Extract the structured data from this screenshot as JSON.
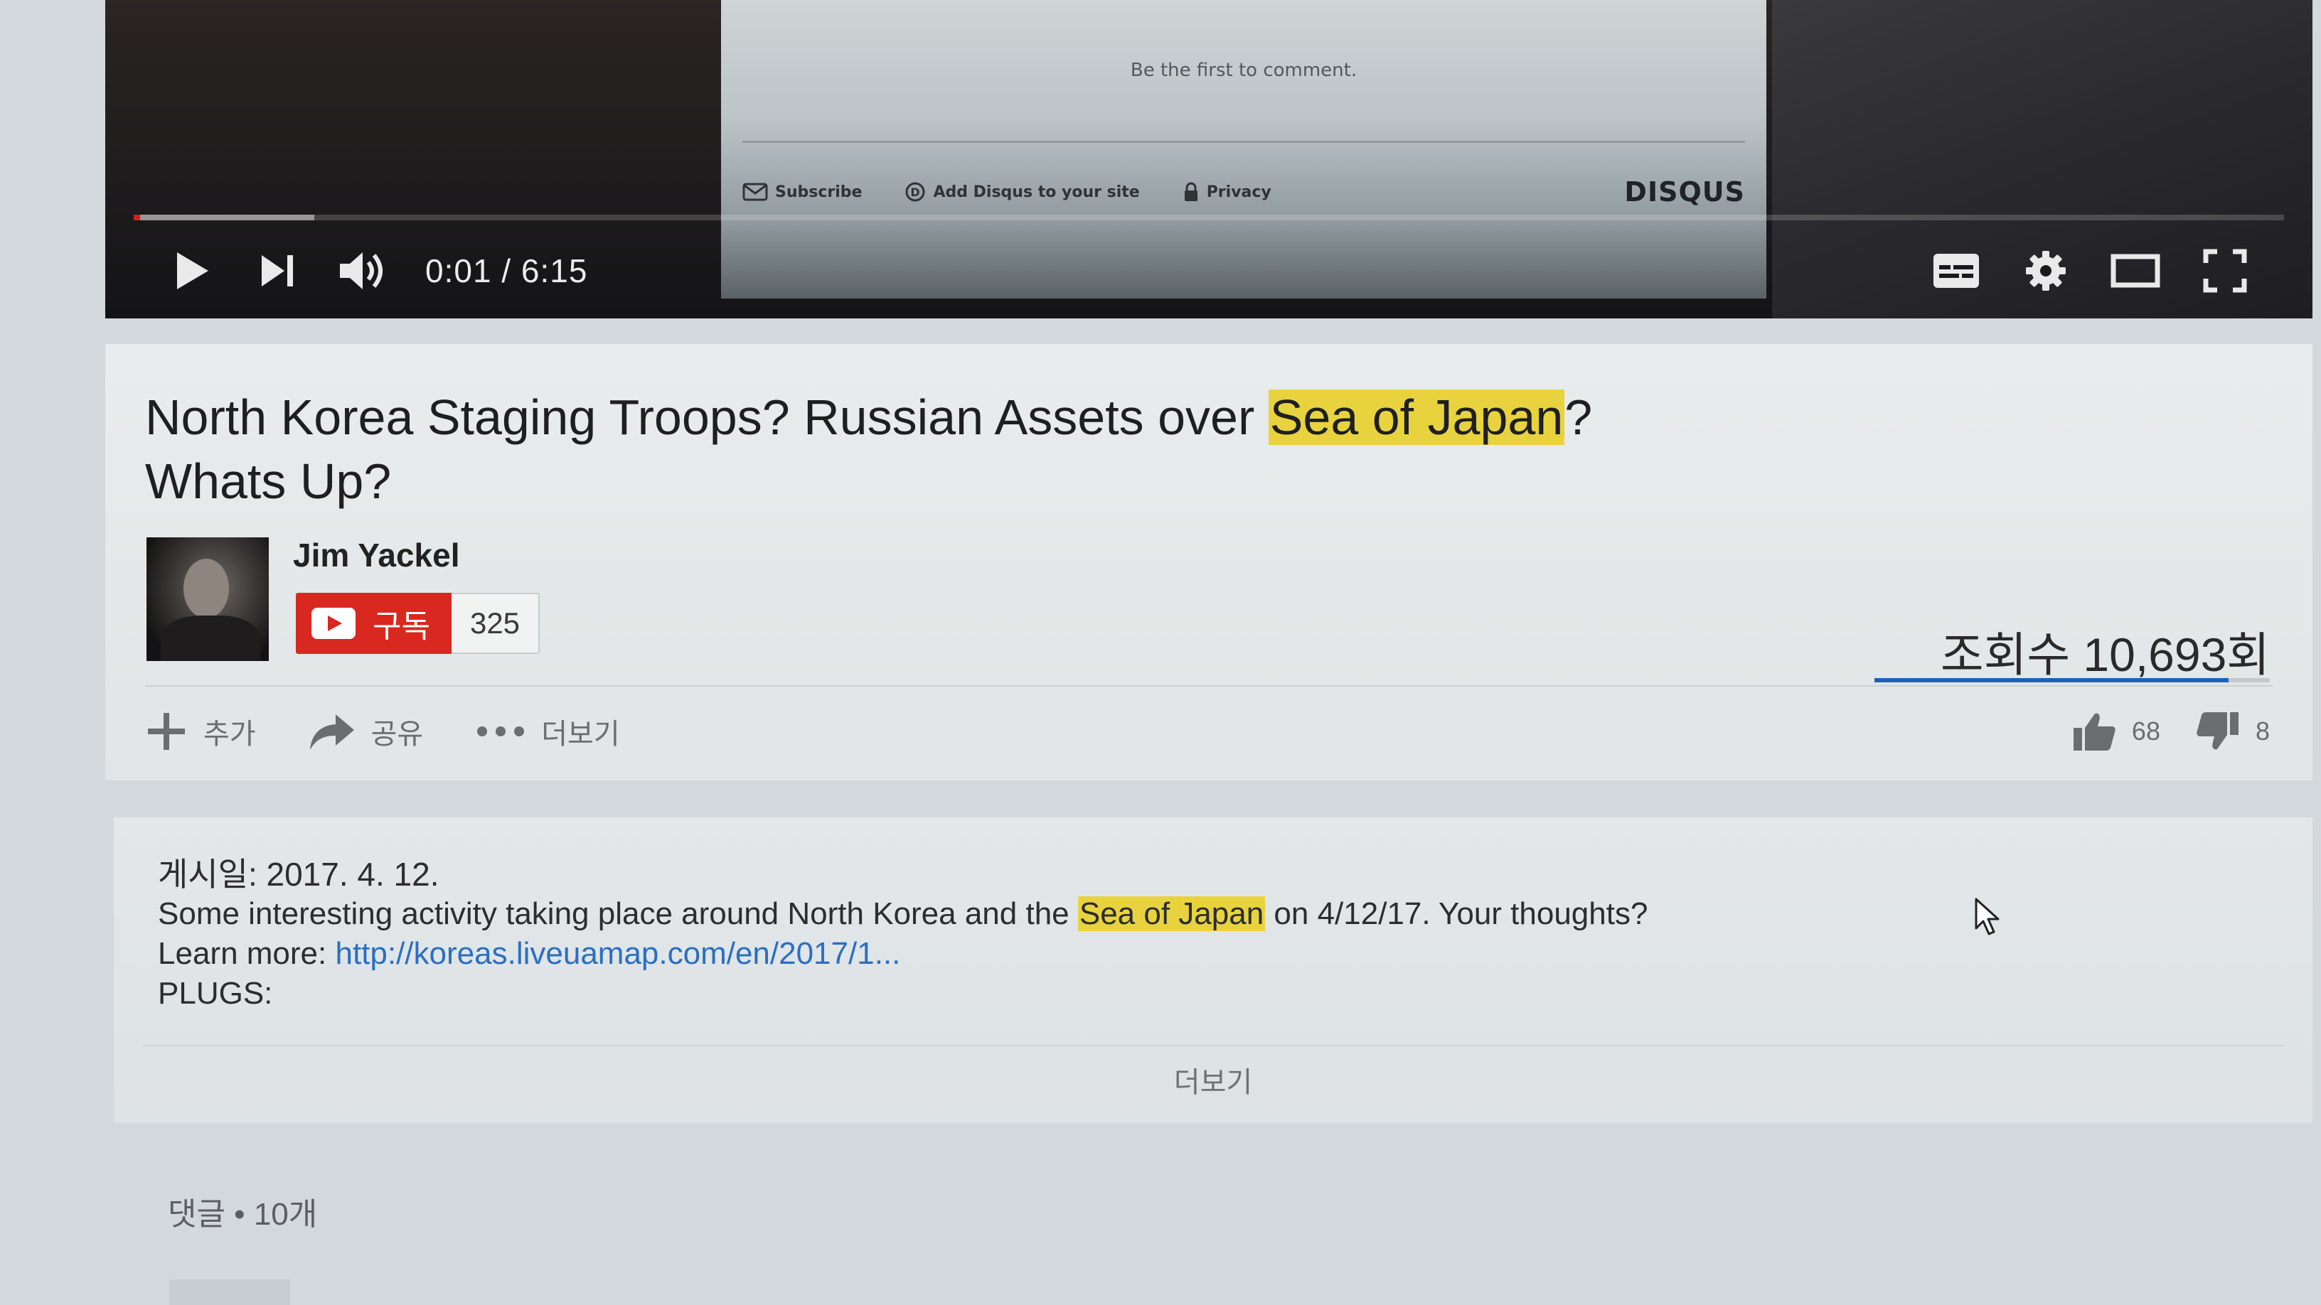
{
  "player": {
    "disqus": {
      "first_comment": "Be the first to comment.",
      "subscribe": "Subscribe",
      "add_disqus": "Add Disqus to your site",
      "privacy": "Privacy",
      "brand": "DISQUS"
    },
    "time": "0:01 / 6:15",
    "progress_played_fraction": 0.003,
    "progress_buffered_fraction": 0.084,
    "icons": {
      "play": "play-icon",
      "next": "next-icon",
      "volume": "volume-icon",
      "subtitles": "subtitles-icon",
      "settings": "gear-icon",
      "theater": "theater-mode-icon",
      "fullscreen": "fullscreen-icon"
    }
  },
  "video": {
    "title_before": "North Korea Staging Troops? Russian Assets over ",
    "title_highlight": "Sea of Japan",
    "title_after": "?",
    "title_line2": "Whats Up?",
    "channel": "Jim Yackel",
    "subscribe_label": "구독",
    "subscriber_count": "325",
    "views": "조회수 10,693회",
    "like_fraction": 0.895,
    "actions": {
      "add": "추가",
      "share": "공유",
      "more": "더보기"
    },
    "likes": "68",
    "dislikes": "8"
  },
  "description": {
    "published": "게시일: 2017. 4. 12.",
    "text_before": "Some interesting activity taking place around North Korea and the ",
    "text_highlight": "Sea of Japan",
    "text_after": " on 4/12/17. Your thoughts?",
    "learn_more_label": "Learn more: ",
    "learn_more_link": "http://koreas.liveuamap.com/en/2017/1...",
    "plugs": "PLUGS:",
    "show_more": "더보기"
  },
  "comments": {
    "header": "댓글 • 10개"
  },
  "colors": {
    "accent_red": "#d9281f",
    "highlight": "#e8d33f",
    "link": "#2a6fc2"
  }
}
